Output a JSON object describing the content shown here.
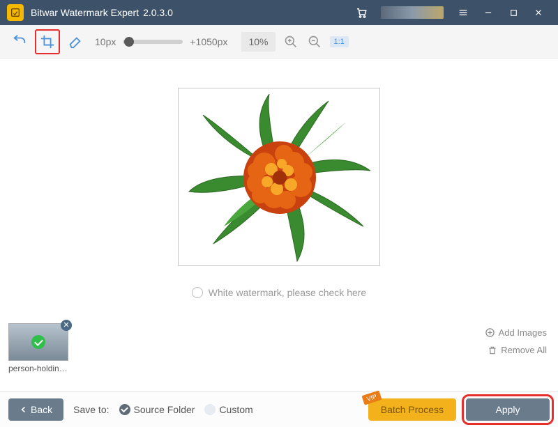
{
  "titlebar": {
    "app_name": "Bitwar Watermark Expert",
    "version": "2.0.3.0"
  },
  "toolbar": {
    "size_min_label": "10px",
    "size_max_label": "+1050px",
    "zoom_pct": "10%",
    "fit_label": "1:1"
  },
  "canvas": {
    "white_watermark_label": "White watermark, please check here"
  },
  "thumbs": {
    "items": [
      {
        "filename": "person-holding-fil..."
      }
    ],
    "add_label": "Add Images",
    "remove_label": "Remove All"
  },
  "bottom": {
    "back_label": "Back",
    "save_to_label": "Save to:",
    "source_folder_label": "Source Folder",
    "custom_label": "Custom",
    "batch_label": "Batch Process",
    "vip_tag": "VIP",
    "apply_label": "Apply"
  }
}
